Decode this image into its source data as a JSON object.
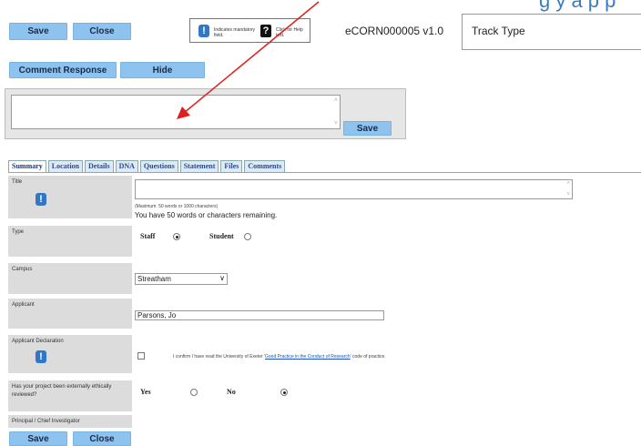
{
  "header": {
    "top_text": "g y  a p p",
    "save_label": "Save",
    "close_label": "Close",
    "legend_mandatory": "Indicates mandatory field.",
    "legend_help": "Click for Help text.",
    "reference": "eCORN000005 v1.0",
    "track_type": "Track Type"
  },
  "comments": {
    "comment_response_label": "Comment Response",
    "hide_label": "Hide",
    "save_label": "Save"
  },
  "tabs": [
    "Summary",
    "Location",
    "Details",
    "DNA",
    "Questions",
    "Statement",
    "Files",
    "Comments"
  ],
  "form": {
    "title_label": "Title",
    "title_max": "(Maximum: 50 words or 1000 characters)",
    "title_remaining": "You have 50 words or  characters remaining.",
    "type_label": "Type",
    "type_staff": "Staff",
    "type_student": "Student",
    "campus_label": "Campus",
    "campus_value": "Streatham",
    "applicant_label": "Applicant",
    "applicant_value": "Parsons, Jo",
    "declaration_label": "Applicant Declaration",
    "declaration_text_pre": "I confirm I have read the University of Exeter '",
    "declaration_link": "Good Practice in the Conduct of Research",
    "declaration_text_post": "' code of practice.",
    "ethics_label": "Has your project been externally ethically reviewed?",
    "ethics_yes": "Yes",
    "ethics_no": "No",
    "pi_label": "Principal / Chief Investigator"
  },
  "footer": {
    "save_label": "Save",
    "close_label": "Close"
  },
  "colors": {
    "button": "#8dc3ee",
    "annotation_arrow": "#e02020",
    "required_icon": "#2f78c8"
  }
}
